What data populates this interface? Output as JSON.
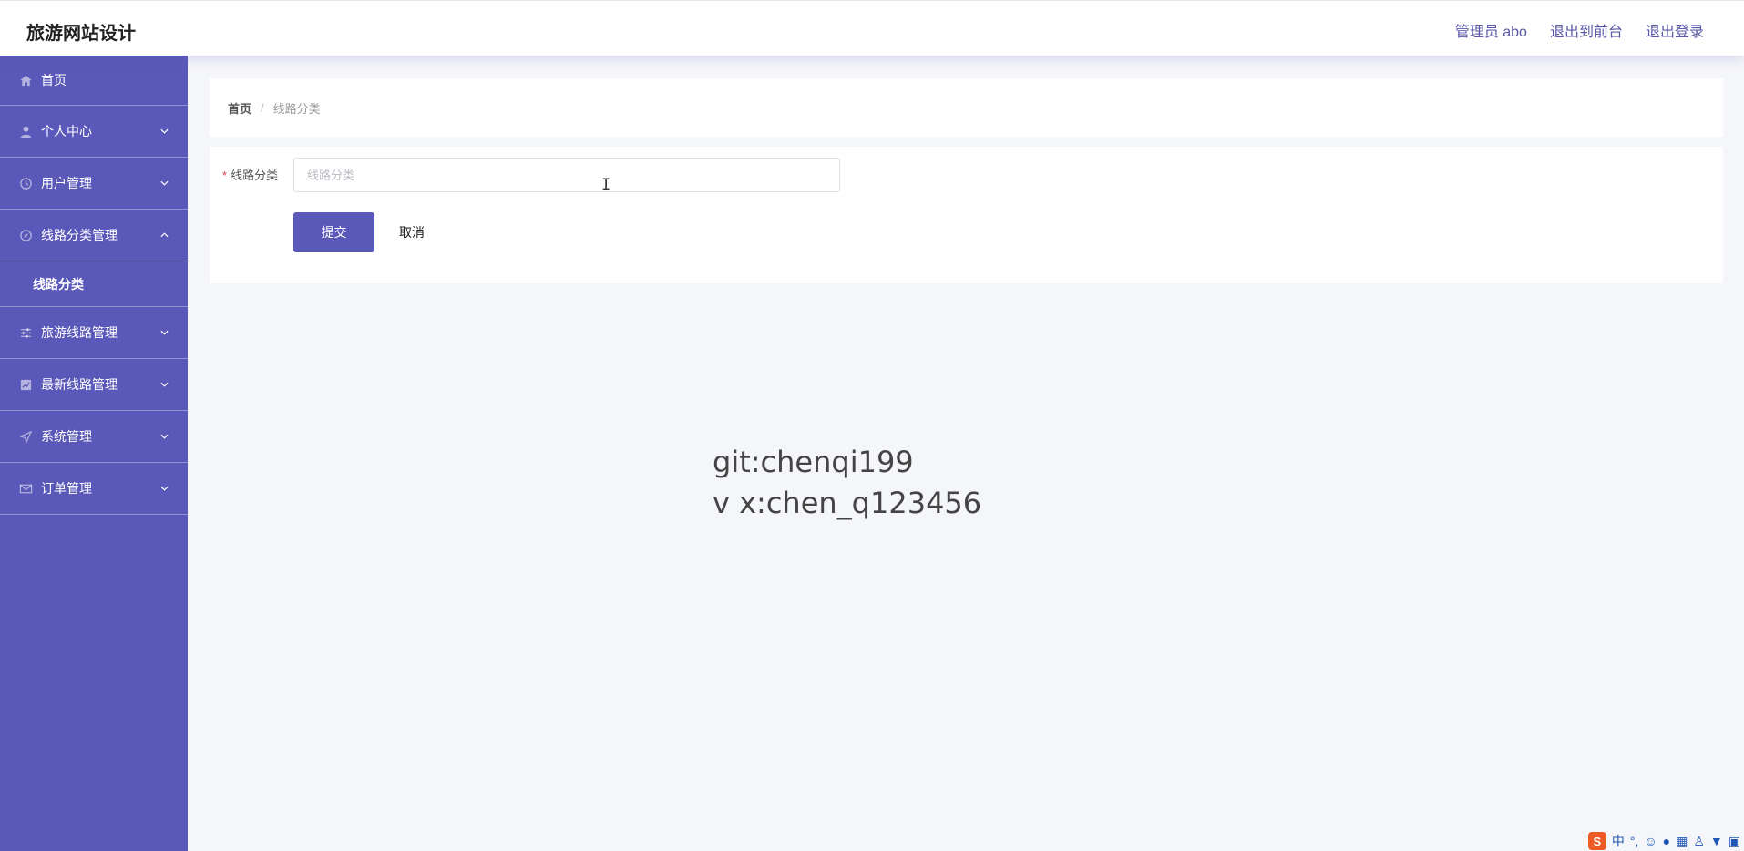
{
  "app": {
    "title": "旅游网站设计"
  },
  "header": {
    "admin_label": "管理员 abo",
    "frontend_link": "退出到前台",
    "logout_link": "退出登录"
  },
  "sidebar": {
    "items": [
      {
        "label": "首页",
        "icon": "home-icon"
      },
      {
        "label": "个人中心",
        "icon": "user-icon"
      },
      {
        "label": "用户管理",
        "icon": "clock-icon"
      },
      {
        "label": "线路分类管理",
        "icon": "compass-icon"
      },
      {
        "label": "旅游线路管理",
        "icon": "sliders-icon"
      },
      {
        "label": "最新线路管理",
        "icon": "chart-icon"
      },
      {
        "label": "系统管理",
        "icon": "send-icon"
      },
      {
        "label": "订单管理",
        "icon": "mail-icon"
      }
    ],
    "submenu_label": "线路分类"
  },
  "breadcrumb": {
    "home": "首页",
    "separator": "/",
    "current": "线路分类"
  },
  "form": {
    "required_mark": "*",
    "label": "线路分类",
    "placeholder": "线路分类",
    "value": "",
    "submit_label": "提交",
    "cancel_label": "取消"
  },
  "watermark": {
    "line1": "git:chenqi199",
    "line2": "v x:chen_q123456"
  },
  "ime_tray": {
    "logo": "S",
    "mode": "中"
  },
  "colors": {
    "accent": "#5a58b8",
    "background": "#f5f6f9",
    "required": "#e0444a"
  }
}
